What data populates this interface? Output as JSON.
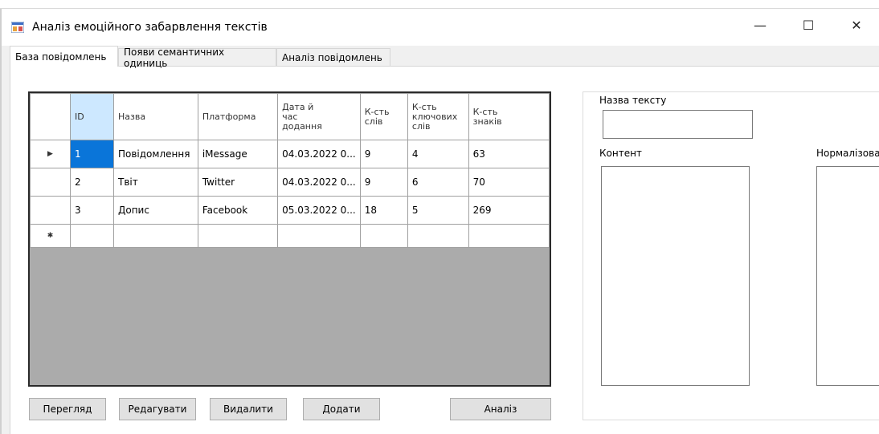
{
  "window": {
    "title": "Аналіз емоційного забарвлення текстів",
    "minimize_glyph": "—",
    "maximize_glyph": "☐",
    "close_glyph": "✕"
  },
  "tabs": [
    {
      "label": "База повідомлень",
      "active": true
    },
    {
      "label": "Появи семантичних одиниць",
      "active": false
    },
    {
      "label": "Аналіз повідомлень",
      "active": false
    }
  ],
  "grid": {
    "columns": [
      "ID",
      "Назва",
      "Платформа",
      "Дата й\nчас\nдодання",
      "К-сть\nслів",
      "К-сть\nключових\nслів",
      "К-сть\nзнаків"
    ],
    "rows": [
      {
        "marker": "▶",
        "cells": [
          "1",
          "Повідомлення",
          "iMessage",
          "04.03.2022 0...",
          "9",
          "4",
          "63"
        ]
      },
      {
        "marker": "",
        "cells": [
          "2",
          "Твіт",
          "Twitter",
          "04.03.2022 0...",
          "9",
          "6",
          "70"
        ]
      },
      {
        "marker": "",
        "cells": [
          "3",
          "Допис",
          "Facebook",
          "05.03.2022 0...",
          "18",
          "5",
          "269"
        ]
      }
    ],
    "new_row_marker": "✱"
  },
  "buttons": {
    "view": "Перегляд",
    "edit": "Редагувати",
    "delete": "Видалити",
    "add": "Додати",
    "analyze": "Аналіз"
  },
  "details": {
    "name_label": "Назва тексту",
    "name_value": "",
    "content_label": "Контент",
    "content_value": "",
    "normalized_label": "Нормалізова",
    "normalized_value": ""
  },
  "colors": {
    "selection": "#0a75d9",
    "header_selected": "#cde8ff",
    "grid_empty": "#ababab",
    "form_bg": "#f0f0f0"
  },
  "icons": {
    "app": "app-windows-form-icon",
    "current_row": "row-pointer-icon",
    "new_row": "new-row-asterisk-icon"
  }
}
